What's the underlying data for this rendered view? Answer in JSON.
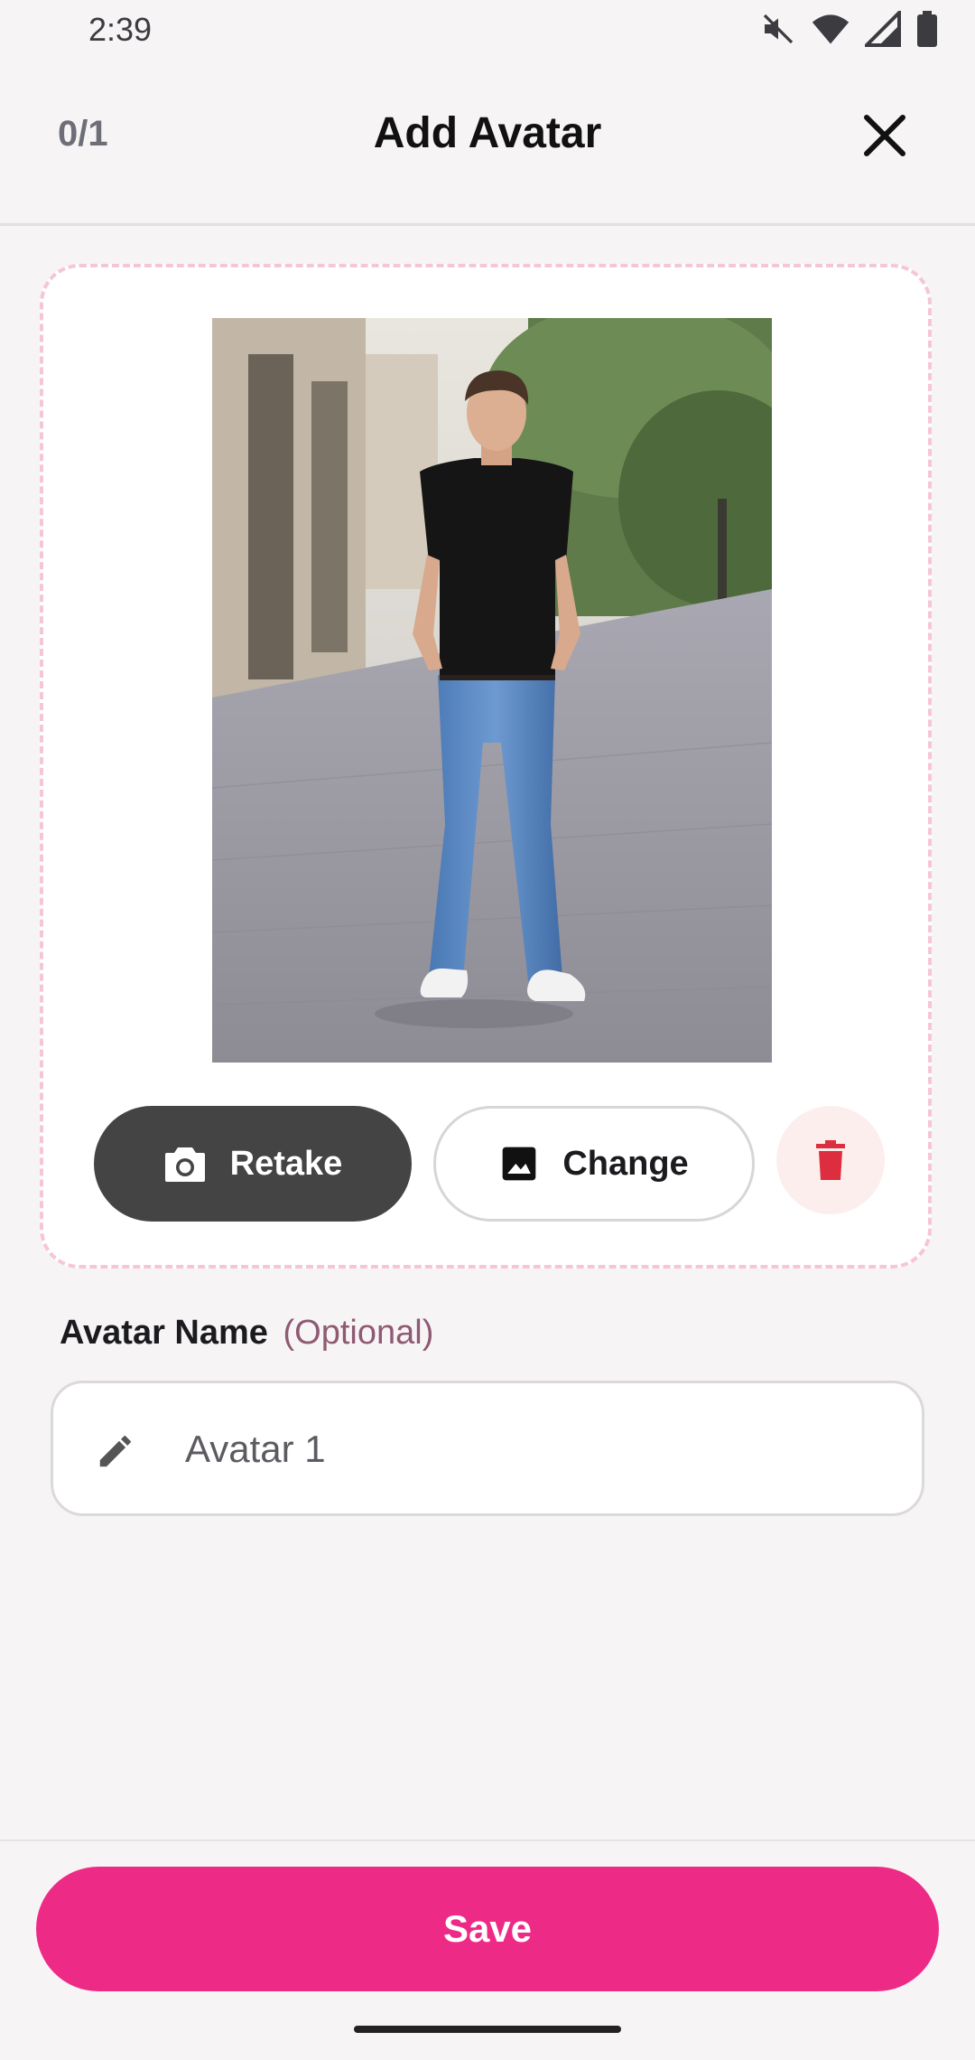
{
  "status_bar": {
    "time": "2:39",
    "icons": [
      "mute-icon",
      "wifi-icon",
      "signal-icon",
      "battery-icon"
    ]
  },
  "header": {
    "counter": "0/1",
    "title": "Add Avatar",
    "close_icon": "close-icon"
  },
  "photo_card": {
    "image": "full-body photo of a man in a black t-shirt and blue jeans on a city street",
    "border_color": "#f6c6d8",
    "retake_label": "Retake",
    "retake_icon": "camera-icon",
    "change_label": "Change",
    "change_icon": "image-icon",
    "delete_icon": "trash-icon"
  },
  "name_field": {
    "label": "Avatar Name",
    "optional": "(Optional)",
    "value": "Avatar 1",
    "icon": "pencil-icon"
  },
  "footer": {
    "save_label": "Save"
  },
  "colors": {
    "accent": "#ee2a87",
    "retake_bg": "#444444",
    "delete_icon": "#dc2e3e",
    "optional_text": "#8e5a72"
  }
}
